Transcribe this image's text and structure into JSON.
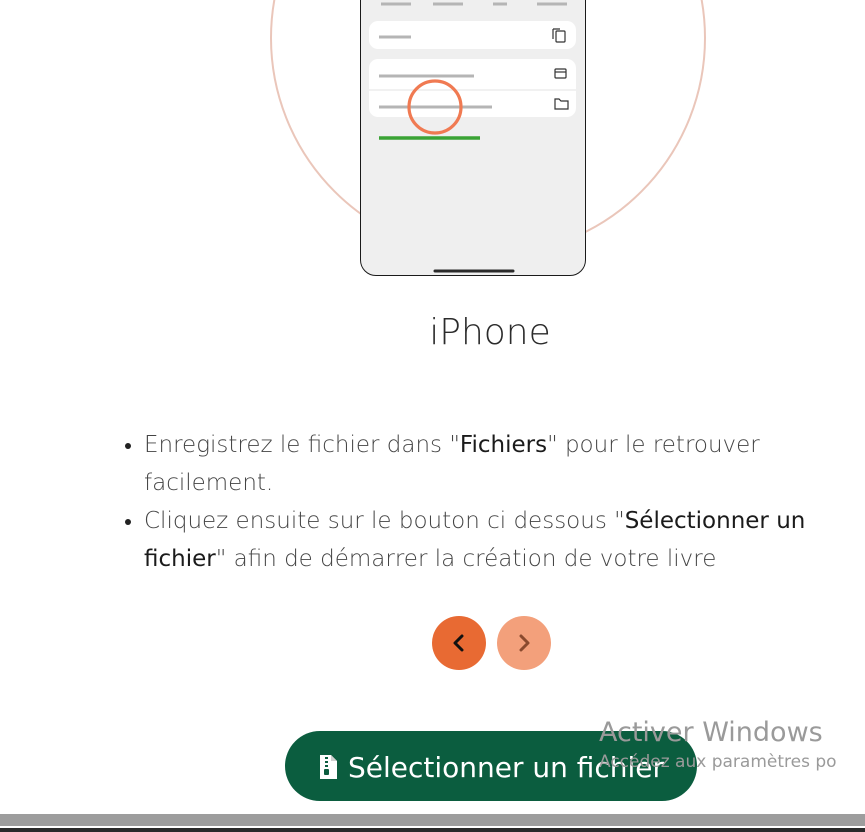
{
  "device": {
    "title": "iPhone"
  },
  "instructions": [
    {
      "before": "Enregistrez le fichier dans \"",
      "highlight": "Fichiers",
      "after": "\" pour le retrouver facilement."
    },
    {
      "before": "Cliquez ensuite sur le bouton ci dessous \"",
      "highlight": "Sélectionner un fichier",
      "after": "\" afin de démarrer la création de votre livre"
    }
  ],
  "navigation": {
    "prev_icon": "chevron-left-icon",
    "next_icon": "chevron-right-icon"
  },
  "action": {
    "label": "Sélectionner un fichier",
    "icon": "file-zip-icon"
  },
  "watermark": {
    "line1": "Activer Windows",
    "line2": "Accédez aux paramètres po"
  },
  "colors": {
    "accent": "#e86a33",
    "accent_light": "#f3a07b",
    "primary": "#0b5d3f",
    "highlight_line": "#3aa335"
  }
}
